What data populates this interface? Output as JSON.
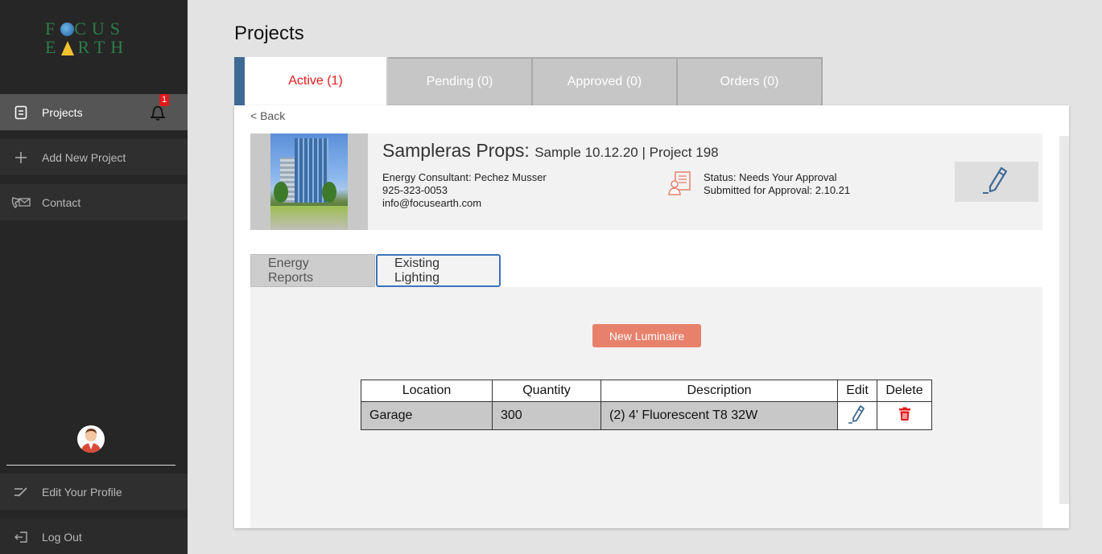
{
  "sidebar": {
    "logo": {
      "line1a": "F",
      "line1b": "CUS",
      "line2a": "E",
      "line2b": "RTH"
    },
    "items": [
      {
        "label": "Projects",
        "active": true
      },
      {
        "label": "Add New Project"
      },
      {
        "label": "Contact"
      }
    ],
    "notification_count": "1",
    "bottom_items": [
      {
        "label": "Edit Your Profile"
      },
      {
        "label": "Log Out"
      }
    ]
  },
  "page": {
    "title": "Projects"
  },
  "tabs": [
    {
      "label": "Active (1)",
      "active": true
    },
    {
      "label": "Pending (0)"
    },
    {
      "label": "Approved (0)"
    },
    {
      "label": "Orders (0)"
    }
  ],
  "back_label": "< Back",
  "project": {
    "name": "Sampleras Props:",
    "subtitle": "Sample 10.12.20 | Project 198",
    "consultant": "Energy Consultant: Pechez Musser",
    "phone": "925-323-0053",
    "email": "info@focusearth.com",
    "status": "Status: Needs Your Approval",
    "submitted": "Submitted for Approval: 2.10.21"
  },
  "subtabs": [
    {
      "label": "Energy Reports"
    },
    {
      "label": "Existing Lighting",
      "active": true
    }
  ],
  "new_luminaire_label": "New Luminaire",
  "table": {
    "headers": [
      "Location",
      "Quantity",
      "Description",
      "Edit",
      "Delete"
    ],
    "rows": [
      {
        "location": "Garage",
        "quantity": "300",
        "description": "(2) 4' Fluorescent T8 32W"
      }
    ]
  },
  "colors": {
    "accent_red": "#e21a1a",
    "tab_accent": "#3f6a94",
    "button_salmon": "#e8816b",
    "sidebar_bg": "#262626"
  }
}
